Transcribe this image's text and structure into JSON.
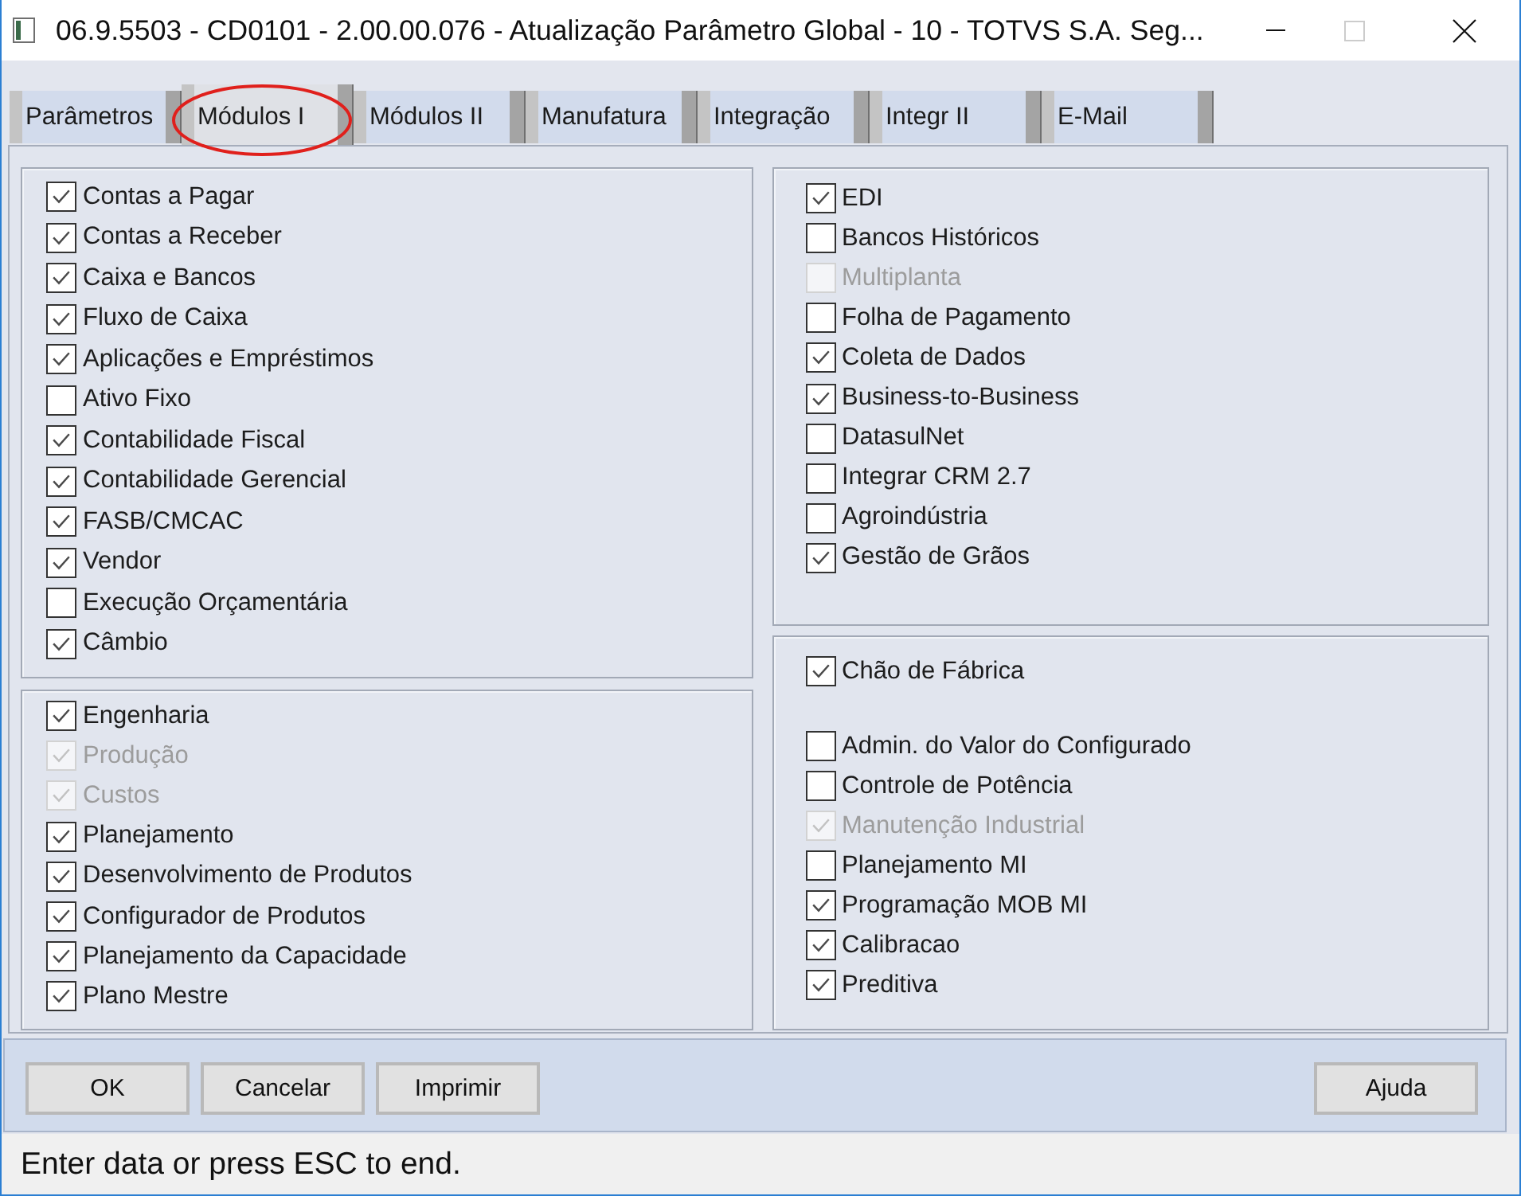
{
  "window": {
    "title": "06.9.5503 - CD0101 - 2.00.00.076 - Atualização Parâmetro Global - 10 - TOTVS S.A. Seg...",
    "maximize_disabled": true
  },
  "tabs": [
    {
      "label": "Parâmetros",
      "selected": false,
      "circled": false
    },
    {
      "label": "Módulos I",
      "selected": true,
      "circled": true
    },
    {
      "label": "Módulos II",
      "selected": false,
      "circled": false
    },
    {
      "label": "Manufatura",
      "selected": false,
      "circled": false
    },
    {
      "label": "Integração",
      "selected": false,
      "circled": false
    },
    {
      "label": "Integr II",
      "selected": false,
      "circled": false
    },
    {
      "label": "E-Mail",
      "selected": false,
      "circled": false
    }
  ],
  "columns": [
    {
      "panels": [
        {
          "items": [
            {
              "label": "Contas a Pagar",
              "checked": true,
              "disabled": false
            },
            {
              "label": "Contas a Receber",
              "checked": true,
              "disabled": false
            },
            {
              "label": "Caixa e Bancos",
              "checked": true,
              "disabled": false
            },
            {
              "label": "Fluxo de Caixa",
              "checked": true,
              "disabled": false
            },
            {
              "label": "Aplicações e Empréstimos",
              "checked": true,
              "disabled": false
            },
            {
              "label": "Ativo Fixo",
              "checked": false,
              "disabled": false
            },
            {
              "label": "Contabilidade Fiscal",
              "checked": true,
              "disabled": false
            },
            {
              "label": "Contabilidade Gerencial",
              "checked": true,
              "disabled": false
            },
            {
              "label": "FASB/CMCAC",
              "checked": true,
              "disabled": false
            },
            {
              "label": "Vendor",
              "checked": true,
              "disabled": false
            },
            {
              "label": "Execução Orçamentária",
              "checked": false,
              "disabled": false
            },
            {
              "label": "Câmbio",
              "checked": true,
              "disabled": false
            }
          ]
        },
        {
          "items": [
            {
              "label": "Engenharia",
              "checked": true,
              "disabled": false
            },
            {
              "label": "Produção",
              "checked": true,
              "disabled": true
            },
            {
              "label": "Custos",
              "checked": true,
              "disabled": true
            },
            {
              "label": "Planejamento",
              "checked": true,
              "disabled": false
            },
            {
              "label": "Desenvolvimento de Produtos",
              "checked": true,
              "disabled": false
            },
            {
              "label": "Configurador de Produtos",
              "checked": true,
              "disabled": false
            },
            {
              "label": "Planejamento da Capacidade",
              "checked": true,
              "disabled": false
            },
            {
              "label": "Plano Mestre",
              "checked": true,
              "disabled": false
            }
          ]
        }
      ]
    },
    {
      "panels": [
        {
          "items": [
            {
              "label": "EDI",
              "checked": true,
              "disabled": false
            },
            {
              "label": "Bancos Históricos",
              "checked": false,
              "disabled": false
            },
            {
              "label": "Multiplanta",
              "checked": false,
              "disabled": true
            },
            {
              "label": "Folha de Pagamento",
              "checked": false,
              "disabled": false
            },
            {
              "label": "Coleta de Dados",
              "checked": true,
              "disabled": false
            },
            {
              "label": "Business-to-Business",
              "checked": true,
              "disabled": false
            },
            {
              "label": "DatasulNet",
              "checked": false,
              "disabled": false
            },
            {
              "label": "Integrar CRM 2.7",
              "checked": false,
              "disabled": false
            },
            {
              "label": "Agroindústria",
              "checked": false,
              "disabled": false
            },
            {
              "label": "Gestão de Grãos",
              "checked": true,
              "disabled": false
            }
          ]
        },
        {
          "items": [
            {
              "label": "Chão de Fábrica",
              "checked": true,
              "disabled": false
            },
            {
              "label": "Admin. do Valor do Configurado",
              "checked": false,
              "disabled": false
            },
            {
              "label": "Controle de Potência",
              "checked": false,
              "disabled": false
            },
            {
              "label": "Manutenção Industrial",
              "checked": true,
              "disabled": true
            },
            {
              "label": "Planejamento MI",
              "checked": false,
              "disabled": false
            },
            {
              "label": "Programação MOB MI",
              "checked": true,
              "disabled": false
            },
            {
              "label": "Calibracao",
              "checked": true,
              "disabled": false
            },
            {
              "label": "Preditiva",
              "checked": true,
              "disabled": false
            }
          ]
        }
      ]
    }
  ],
  "button_bar": {
    "buttons": [
      "OK",
      "Cancelar",
      "Imprimir"
    ],
    "help_button": "Ajuda"
  },
  "status_bar": {
    "text": "Enter data or press ESC to end."
  }
}
